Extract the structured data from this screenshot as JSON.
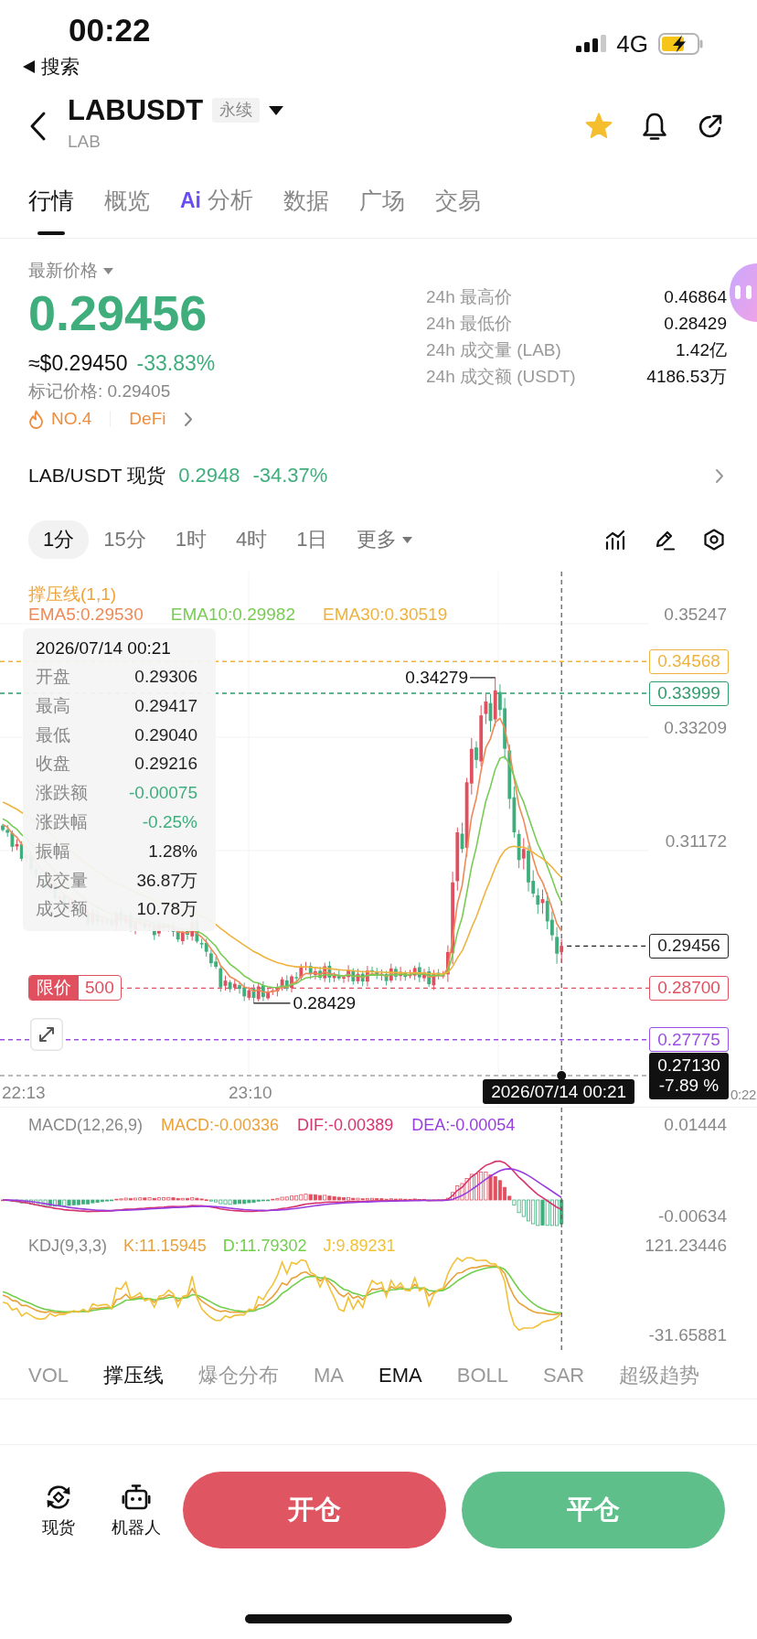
{
  "status_bar": {
    "time": "00:22",
    "back_label": "搜索",
    "network": "4G"
  },
  "header": {
    "symbol": "LABUSDT",
    "contract_tag": "永续",
    "base": "LAB",
    "favorite": true
  },
  "tabs": [
    {
      "label": "行情",
      "selected": true
    },
    {
      "label": "概览",
      "selected": false
    },
    {
      "label": "分析",
      "badge": "Ai",
      "selected": false
    },
    {
      "label": "数据",
      "selected": false
    },
    {
      "label": "广场",
      "selected": false
    },
    {
      "label": "交易",
      "selected": false
    }
  ],
  "price": {
    "title": "最新价格",
    "last": "0.29456",
    "usd": "≈$0.29450",
    "change": "-33.83%",
    "mark": "标记价格: 0.29405",
    "rank": "NO.4",
    "sector": "DeFi"
  },
  "stats": [
    {
      "label": "24h 最高价",
      "value": "0.46864"
    },
    {
      "label": "24h 最低价",
      "value": "0.28429"
    },
    {
      "label": "24h 成交量 (LAB)",
      "value": "1.42亿"
    },
    {
      "label": "24h 成交额 (USDT)",
      "value": "4186.53万"
    }
  ],
  "spot": {
    "label": "LAB/USDT 现货",
    "price": "0.2948",
    "change": "-34.37%"
  },
  "intervals": [
    {
      "label": "1分",
      "kind": "interval",
      "selected": true
    },
    {
      "label": "15分",
      "kind": "interval",
      "selected": false
    },
    {
      "label": "1时",
      "kind": "interval",
      "selected": false
    },
    {
      "label": "4时",
      "kind": "interval",
      "selected": false
    },
    {
      "label": "1日",
      "kind": "interval",
      "selected": false
    },
    {
      "label": "更多",
      "kind": "menu",
      "selected": false
    }
  ],
  "chart": {
    "indicator_label": "撑压线(1,1)",
    "ema_legend": [
      {
        "label": "EMA5:0.29530",
        "color": "#ef8a58"
      },
      {
        "label": "EMA10:0.29982",
        "color": "#78cc55"
      },
      {
        "label": "EMA30:0.30519",
        "color": "#eeb23e"
      }
    ],
    "y_labels": [
      "0.35247",
      "0.33209",
      "0.31172"
    ],
    "price_lines": [
      {
        "value": "0.34568",
        "kind": "level",
        "color": "#eeb23e"
      },
      {
        "value": "0.33999",
        "kind": "level",
        "color": "#2f9c6c"
      },
      {
        "value": "0.29456",
        "kind": "last",
        "color": "#222222"
      },
      {
        "value": "0.28700",
        "kind": "order",
        "color": "#e0505f",
        "tag": "限价",
        "quantity": "500"
      },
      {
        "value": "0.27775",
        "kind": "level",
        "color": "#9b4fe0"
      }
    ],
    "high_label": "0.34279",
    "low_label": "0.28429",
    "crosshair": {
      "price": "0.27130",
      "change": "-7.89 %",
      "time": "2026/07/14 00:21"
    },
    "x_labels": [
      "22:13",
      "23:10",
      "0:22"
    ],
    "tooltip": {
      "time": "2026/07/14 00:21",
      "rows": [
        {
          "label": "开盘",
          "value": "0.29306",
          "color": "#222222"
        },
        {
          "label": "最高",
          "value": "0.29417",
          "color": "#222222"
        },
        {
          "label": "最低",
          "value": "0.29040",
          "color": "#222222"
        },
        {
          "label": "收盘",
          "value": "0.29216",
          "color": "#222222"
        },
        {
          "label": "涨跌额",
          "value": "-0.00075",
          "color": "#3fae7c"
        },
        {
          "label": "涨跌幅",
          "value": "-0.25%",
          "color": "#3fae7c"
        },
        {
          "label": "振幅",
          "value": "1.28%",
          "color": "#222222"
        },
        {
          "label": "成交量",
          "value": "36.87万",
          "color": "#222222"
        },
        {
          "label": "成交额",
          "value": "10.78万",
          "color": "#222222"
        }
      ]
    }
  },
  "macd": {
    "title": "MACD(12,26,9)",
    "values": [
      {
        "label": "MACD:-0.00336",
        "color": "#e9a23b"
      },
      {
        "label": "DIF:-0.00389",
        "color": "#d6336f"
      },
      {
        "label": "DEA:-0.00054",
        "color": "#9a3de0"
      }
    ],
    "y_labels": [
      "0.01444",
      "-0.00634"
    ]
  },
  "kdj": {
    "title": "KDJ(9,3,3)",
    "values": [
      {
        "label": "K:11.15945",
        "color": "#e9a23b"
      },
      {
        "label": "D:11.79302",
        "color": "#72cf4c"
      },
      {
        "label": "J:9.89231",
        "color": "#f0c23a"
      }
    ],
    "y_labels": [
      "121.23446",
      "-31.65881"
    ]
  },
  "indicator_tabs": [
    {
      "label": "VOL",
      "selected": false
    },
    {
      "label": "撑压线",
      "selected": true
    },
    {
      "label": "爆仓分布",
      "selected": false
    },
    {
      "label": "MA",
      "selected": false
    },
    {
      "label": "EMA",
      "selected": true
    },
    {
      "label": "BOLL",
      "selected": false
    },
    {
      "label": "SAR",
      "selected": false
    },
    {
      "label": "超级趋势",
      "selected": false
    }
  ],
  "bottom_bar": {
    "shortcuts": [
      {
        "label": "现货",
        "kind": "spot"
      },
      {
        "label": "机器人",
        "kind": "robot"
      }
    ],
    "actions": [
      {
        "label": "开仓",
        "kind": "open"
      },
      {
        "label": "平仓",
        "kind": "close"
      }
    ]
  }
}
